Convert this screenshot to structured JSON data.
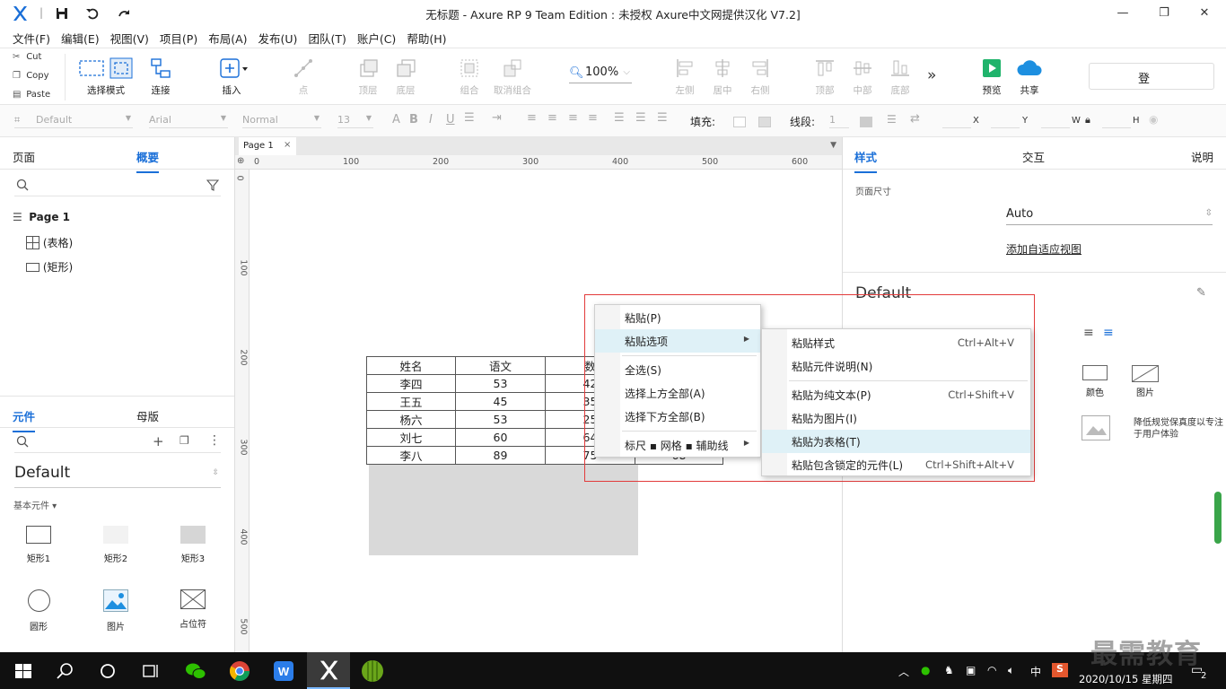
{
  "titlebar": {
    "title": "无标题 - Axure RP 9 Team Edition : 未授权     Axure中文网提供汉化 V7.2]",
    "minimize": "—",
    "restore": "❐",
    "close": "✕"
  },
  "menu": [
    "文件(F)",
    "编辑(E)",
    "视图(V)",
    "项目(P)",
    "布局(A)",
    "发布(U)",
    "团队(T)",
    "账户(C)",
    "帮助(H)"
  ],
  "clipboard": {
    "cut": "Cut",
    "copy": "Copy",
    "paste": "Paste"
  },
  "toolbar": {
    "select_mode": "选择模式",
    "connect": "连接",
    "insert": "插入",
    "point": "点",
    "top_layer": "顶层",
    "bottom_layer": "底层",
    "group": "组合",
    "ungroup": "取消组合",
    "zoom": "100%",
    "left": "左侧",
    "center": "居中",
    "right": "右侧",
    "top": "顶部",
    "middle": "中部",
    "bottom": "底部",
    "more": "»",
    "preview": "预览",
    "share": "共享",
    "login": "登"
  },
  "stylebar": {
    "style": "Default",
    "font": "Arial",
    "weight": "Normal",
    "size": "13",
    "fill": "填充:",
    "line": "线段:",
    "line_value": "1",
    "x": "X",
    "y": "Y",
    "w": "W",
    "h": "H"
  },
  "leftpanel": {
    "tab_pages": "页面",
    "tab_outline": "概要",
    "page1": "Page 1",
    "item_table": "(表格)",
    "item_rect": "(矩形)",
    "tab_widgets": "元件",
    "tab_masters": "母版",
    "library": "Default",
    "library_sub": "基本元件 ▾",
    "widgets": [
      "矩形1",
      "矩形2",
      "矩形3",
      "圆形",
      "图片",
      "占位符"
    ]
  },
  "canvas": {
    "page_tab": "Page 1",
    "ruler_h": [
      "0",
      "100",
      "200",
      "300",
      "400",
      "500",
      "600"
    ],
    "ruler_v": [
      "0",
      "100",
      "200",
      "300",
      "400",
      "500"
    ],
    "table": {
      "rows": [
        [
          "姓名",
          "语文",
          "数",
          ""
        ],
        [
          "李四",
          "53",
          "42",
          ""
        ],
        [
          "王五",
          "45",
          "35",
          ""
        ],
        [
          "杨六",
          "53",
          "25",
          ""
        ],
        [
          "刘七",
          "60",
          "64",
          ""
        ],
        [
          "李八",
          "89",
          "75",
          "68"
        ]
      ]
    }
  },
  "rightpanel": {
    "tab_style": "样式",
    "tab_interact": "交互",
    "tab_notes": "说明",
    "page_size_label": "页面尺寸",
    "page_size_value": "Auto",
    "adaptive_link": "添加自适应视图",
    "style_name": "Default",
    "color": "颜色",
    "image": "图片",
    "hint": "降低规觉保真度以专注于用户体验"
  },
  "context_menu": {
    "items": [
      {
        "label": "粘贴(P)"
      },
      {
        "label": "粘贴选项",
        "submenu": true
      },
      {
        "label": "全选(S)"
      },
      {
        "label": "选择上方全部(A)"
      },
      {
        "label": "选择下方全部(B)"
      },
      {
        "label": "标尺 ▪ 网格 ▪ 辅助线",
        "submenu": true
      }
    ],
    "submenu": [
      {
        "label": "粘贴样式",
        "shortcut": "Ctrl+Alt+V"
      },
      {
        "label": "粘贴元件说明(N)",
        "shortcut": ""
      },
      {
        "label": "粘贴为纯文本(P)",
        "shortcut": "Ctrl+Shift+V"
      },
      {
        "label": "粘贴为图片(I)",
        "shortcut": ""
      },
      {
        "label": "粘贴为表格(T)",
        "shortcut": ""
      },
      {
        "label": "粘贴包含锁定的元件(L)",
        "shortcut": "Ctrl+Shift+Alt+V"
      }
    ]
  },
  "taskbar": {
    "tray_lang": "中",
    "clock_date": "2020/10/15 星期四",
    "notif_count": "2",
    "watermark": "最需教育"
  },
  "colors": {
    "accent": "#1a6fd8",
    "highlight": "#dff1f7",
    "frame": "#e23b3b"
  }
}
